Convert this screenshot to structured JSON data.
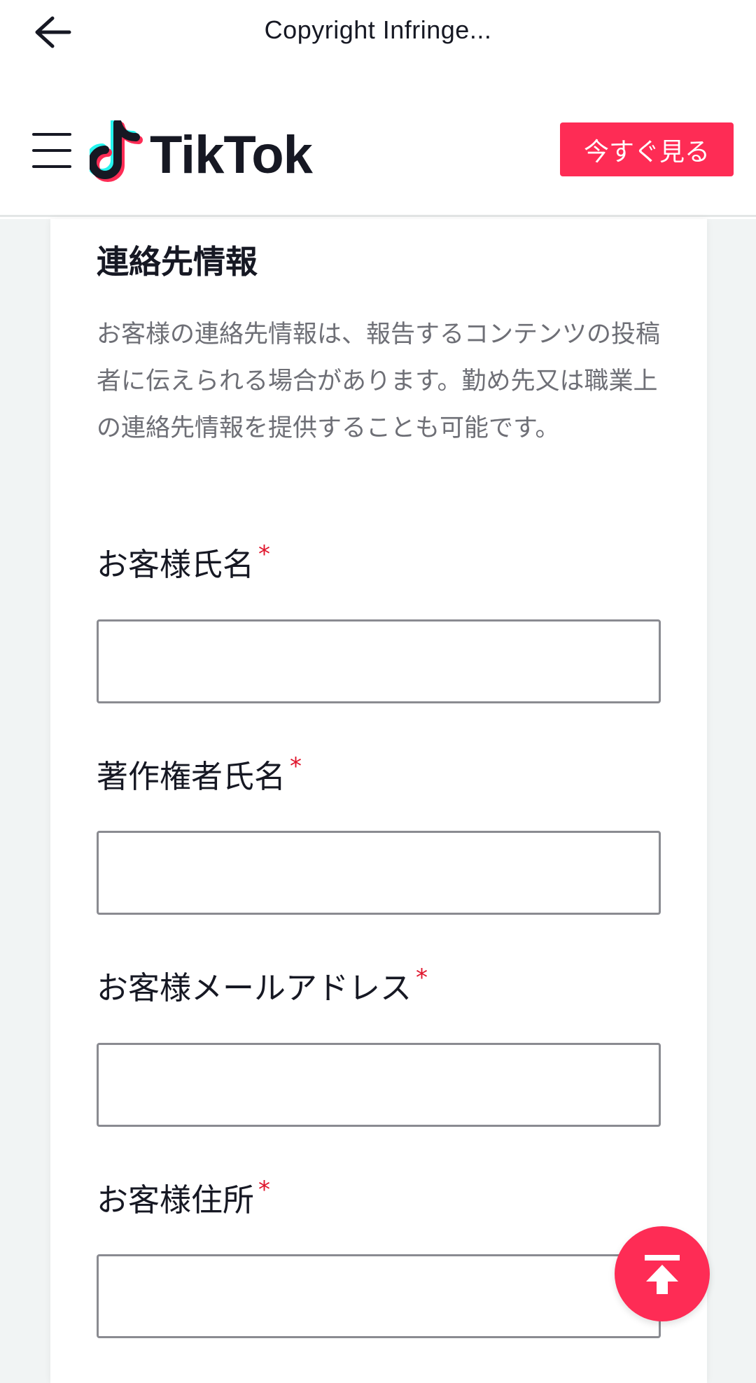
{
  "topbar": {
    "title": "Copyright Infringe..."
  },
  "header": {
    "logo_text": "TikTok",
    "watch_now_label": "今すぐ見る"
  },
  "section": {
    "title": "連絡先情報",
    "description": "お客様の連絡先情報は、報告するコンテンツの投稿者に伝えられる場合があります。勤め先又は職業上の連絡先情報を提供することも可能です。"
  },
  "form": {
    "required_mark": "*",
    "fields": [
      {
        "label": "お客様氏名",
        "value": ""
      },
      {
        "label": "著作権者氏名",
        "value": ""
      },
      {
        "label": "お客様メールアドレス",
        "value": ""
      },
      {
        "label": "お客様住所",
        "value": ""
      }
    ]
  },
  "colors": {
    "accent": "#fe2c55",
    "required": "#e0152c",
    "text": "#161823",
    "muted": "#6e6f76"
  },
  "icons": {
    "back": "arrow-left-icon",
    "menu": "hamburger-menu-icon",
    "logo": "tiktok-note-icon",
    "scroll_top": "arrow-up-to-top-icon"
  }
}
